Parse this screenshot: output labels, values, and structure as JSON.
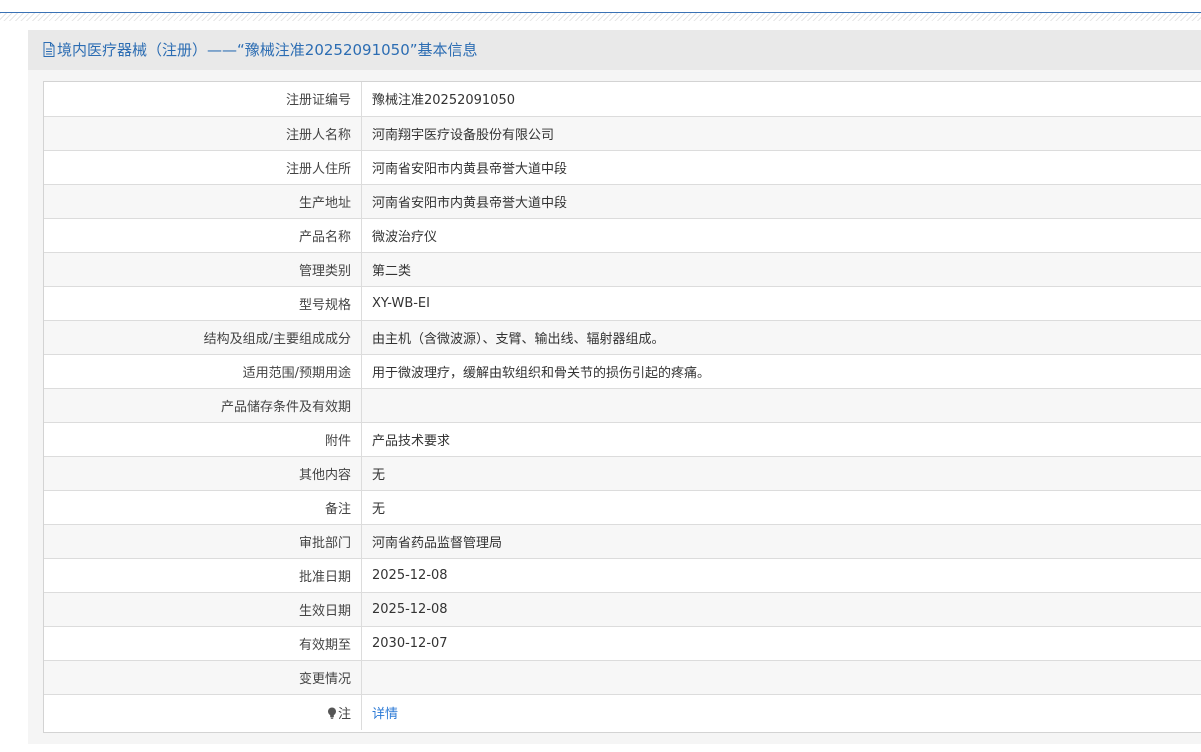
{
  "header": {
    "icon": "document-icon",
    "title": "境内医疗器械（注册）——“豫械注准20252091050”基本信息"
  },
  "rows": [
    {
      "label": "注册证编号",
      "value": "豫械注准20252091050"
    },
    {
      "label": "注册人名称",
      "value": "河南翔宇医疗设备股份有限公司"
    },
    {
      "label": "注册人住所",
      "value": "河南省安阳市内黄县帝誉大道中段"
    },
    {
      "label": "生产地址",
      "value": "河南省安阳市内黄县帝誉大道中段"
    },
    {
      "label": "产品名称",
      "value": "微波治疗仪"
    },
    {
      "label": "管理类别",
      "value": "第二类"
    },
    {
      "label": "型号规格",
      "value": "XY-WB-EI"
    },
    {
      "label": "结构及组成/主要组成成分",
      "value": "由主机（含微波源）、支臂、输出线、辐射器组成。"
    },
    {
      "label": "适用范围/预期用途",
      "value": "用于微波理疗，缓解由软组织和骨关节的损伤引起的疼痛。"
    },
    {
      "label": "产品储存条件及有效期",
      "value": ""
    },
    {
      "label": "附件",
      "value": "产品技术要求"
    },
    {
      "label": "其他内容",
      "value": "无"
    },
    {
      "label": "备注",
      "value": "无"
    },
    {
      "label": "审批部门",
      "value": "河南省药品监督管理局"
    },
    {
      "label": "批准日期",
      "value": "2025-12-08"
    },
    {
      "label": "生效日期",
      "value": "2025-12-08"
    },
    {
      "label": "有效期至",
      "value": "2030-12-07"
    },
    {
      "label": "变更情况",
      "value": ""
    }
  ],
  "note": {
    "icon": "lightbulb-icon",
    "label": "注",
    "link": "详情"
  },
  "colors": {
    "accent": "#2c6db3",
    "link": "#2c7ad6"
  }
}
